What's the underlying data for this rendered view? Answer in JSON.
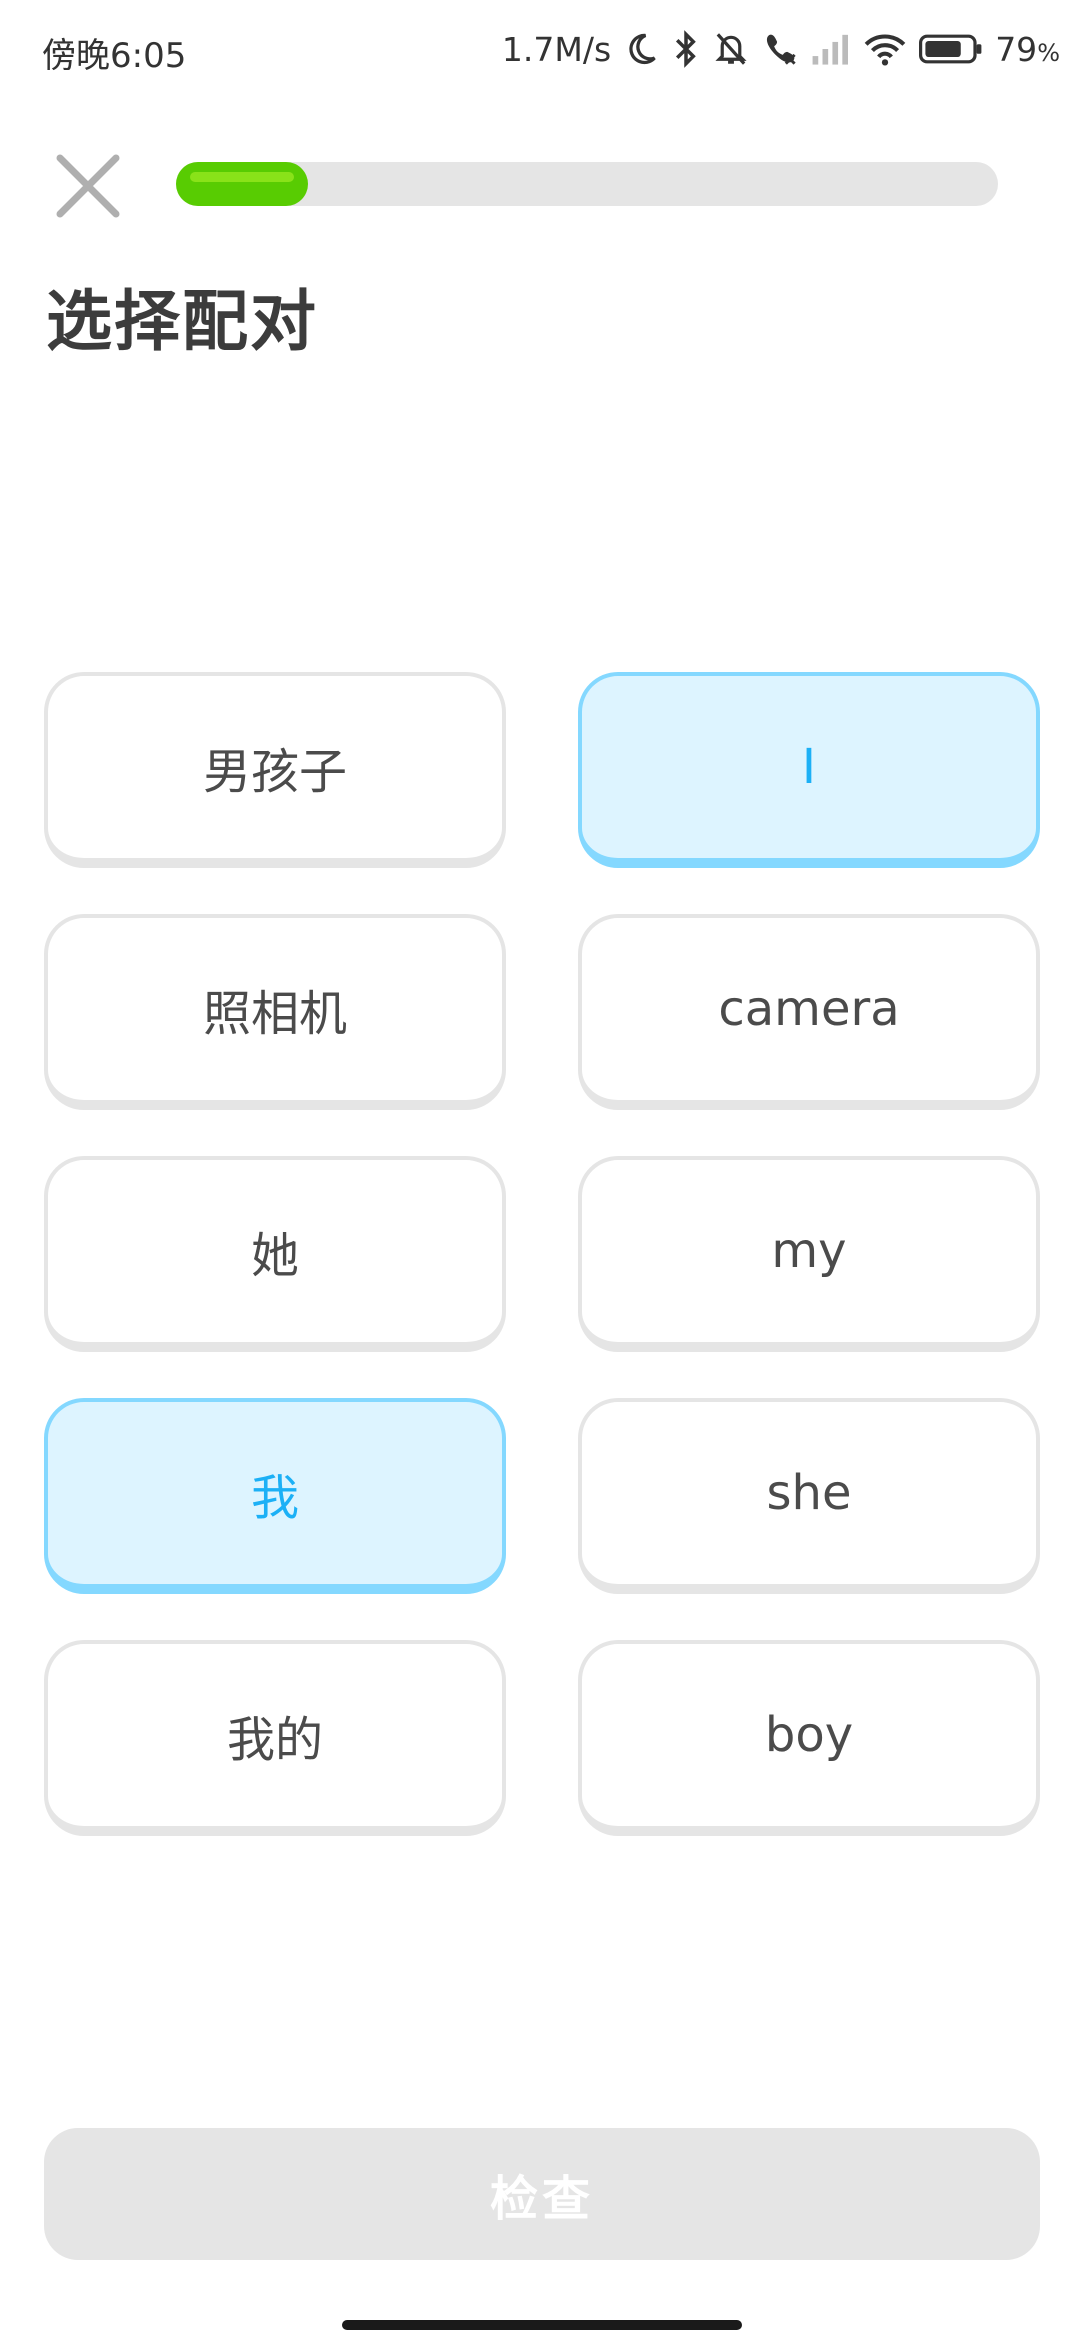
{
  "status_bar": {
    "time": "傍晚6:05",
    "network_speed": "1.7M/s",
    "battery_percent": "79",
    "battery_unit": "%",
    "battery_level": 0.79,
    "icons": [
      "moon-icon",
      "bluetooth-icon",
      "bell-muted-icon",
      "call-icon",
      "signal-icon",
      "wifi-icon",
      "battery-icon"
    ]
  },
  "header": {
    "close_icon": "close-icon",
    "progress_fraction": 0.16
  },
  "page": {
    "title": "选择配对"
  },
  "pairs": {
    "left": [
      {
        "label": "男孩子",
        "selected": false
      },
      {
        "label": "照相机",
        "selected": false
      },
      {
        "label": "她",
        "selected": false
      },
      {
        "label": "我",
        "selected": true
      },
      {
        "label": "我的",
        "selected": false
      }
    ],
    "right": [
      {
        "label": "I",
        "selected": true
      },
      {
        "label": "camera",
        "selected": false
      },
      {
        "label": "my",
        "selected": false
      },
      {
        "label": "she",
        "selected": false
      },
      {
        "label": "boy",
        "selected": false
      }
    ]
  },
  "footer": {
    "check_label": "检查",
    "check_enabled": false
  },
  "colors": {
    "progress_green": "#58cc02",
    "selected_blue": "#1cb0f6",
    "selected_bg": "#ddf4ff",
    "selected_border": "#84d8ff",
    "card_border": "#e5e5e5"
  }
}
